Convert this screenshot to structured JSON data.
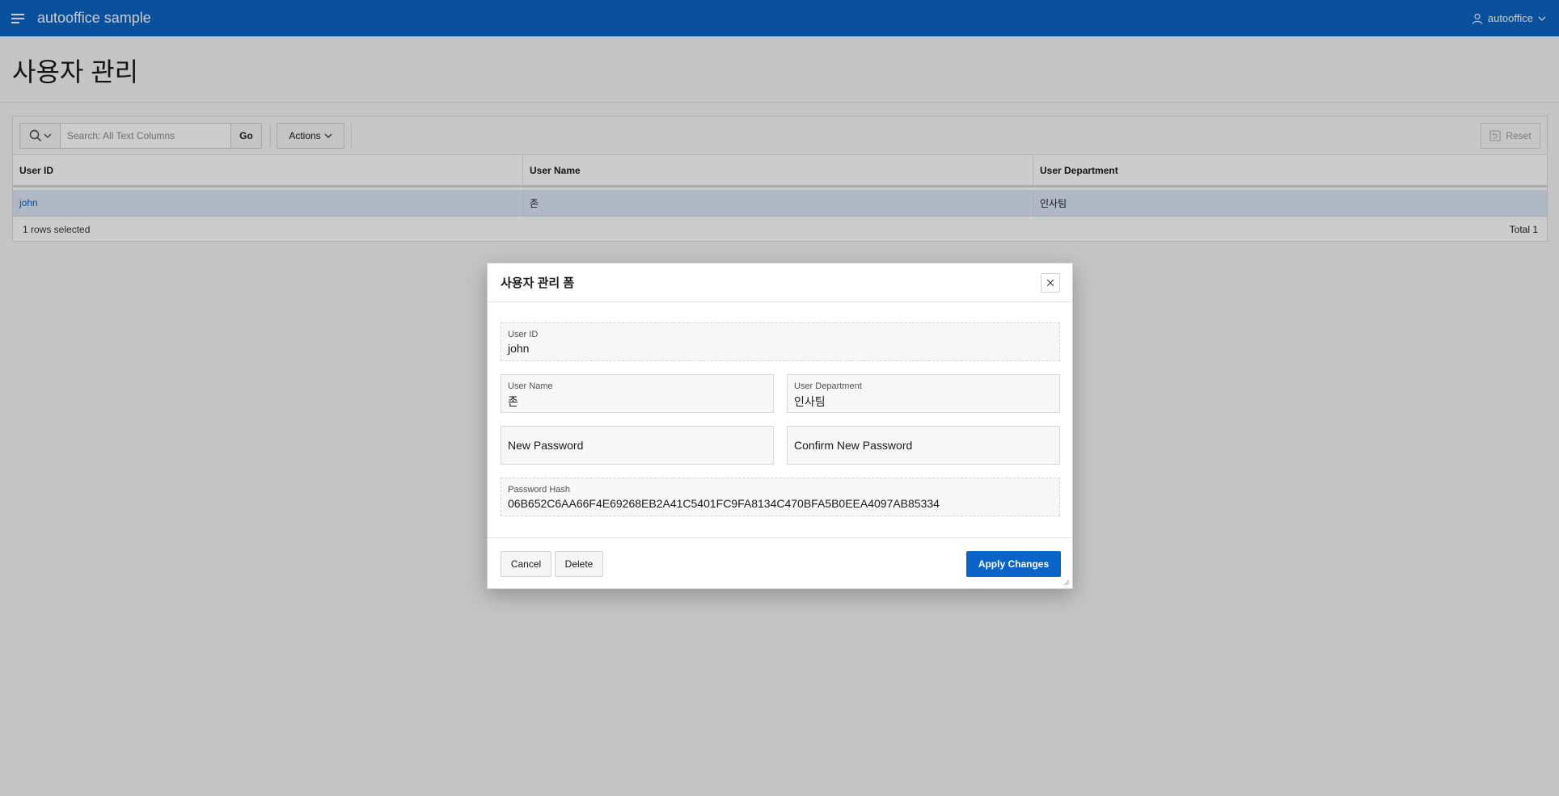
{
  "header": {
    "app_title": "autooffice sample",
    "menu_icon": "hamburger-icon",
    "user": "autooffice",
    "brand_color": "#0a63c4"
  },
  "page": {
    "title": "사용자 관리"
  },
  "report": {
    "search": {
      "placeholder": "Search: All Text Columns",
      "go_label": "Go"
    },
    "actions_label": "Actions",
    "reset_label": "Reset",
    "columns": [
      "User ID",
      "User Name",
      "User Department"
    ],
    "rows": [
      {
        "user_id": "john",
        "user_name": "존",
        "user_department": "인사팀"
      }
    ],
    "selection_status": "1 rows selected",
    "total": "Total 1"
  },
  "dialog": {
    "title": "사용자 관리 폼",
    "fields": {
      "user_id": {
        "label": "User ID",
        "value": "john"
      },
      "user_name": {
        "label": "User Name",
        "value": "존"
      },
      "user_department": {
        "label": "User Department",
        "value": "인사팀"
      },
      "new_password": {
        "label": "New Password",
        "value": ""
      },
      "confirm_password": {
        "label": "Confirm New Password",
        "value": ""
      },
      "password_hash": {
        "label": "Password Hash",
        "value": "06B652C6AA66F4E69268EB2A41C5401FC9FA8134C470BFA5B0EEA4097AB85334"
      }
    },
    "buttons": {
      "cancel": "Cancel",
      "delete": "Delete",
      "apply": "Apply Changes"
    }
  }
}
